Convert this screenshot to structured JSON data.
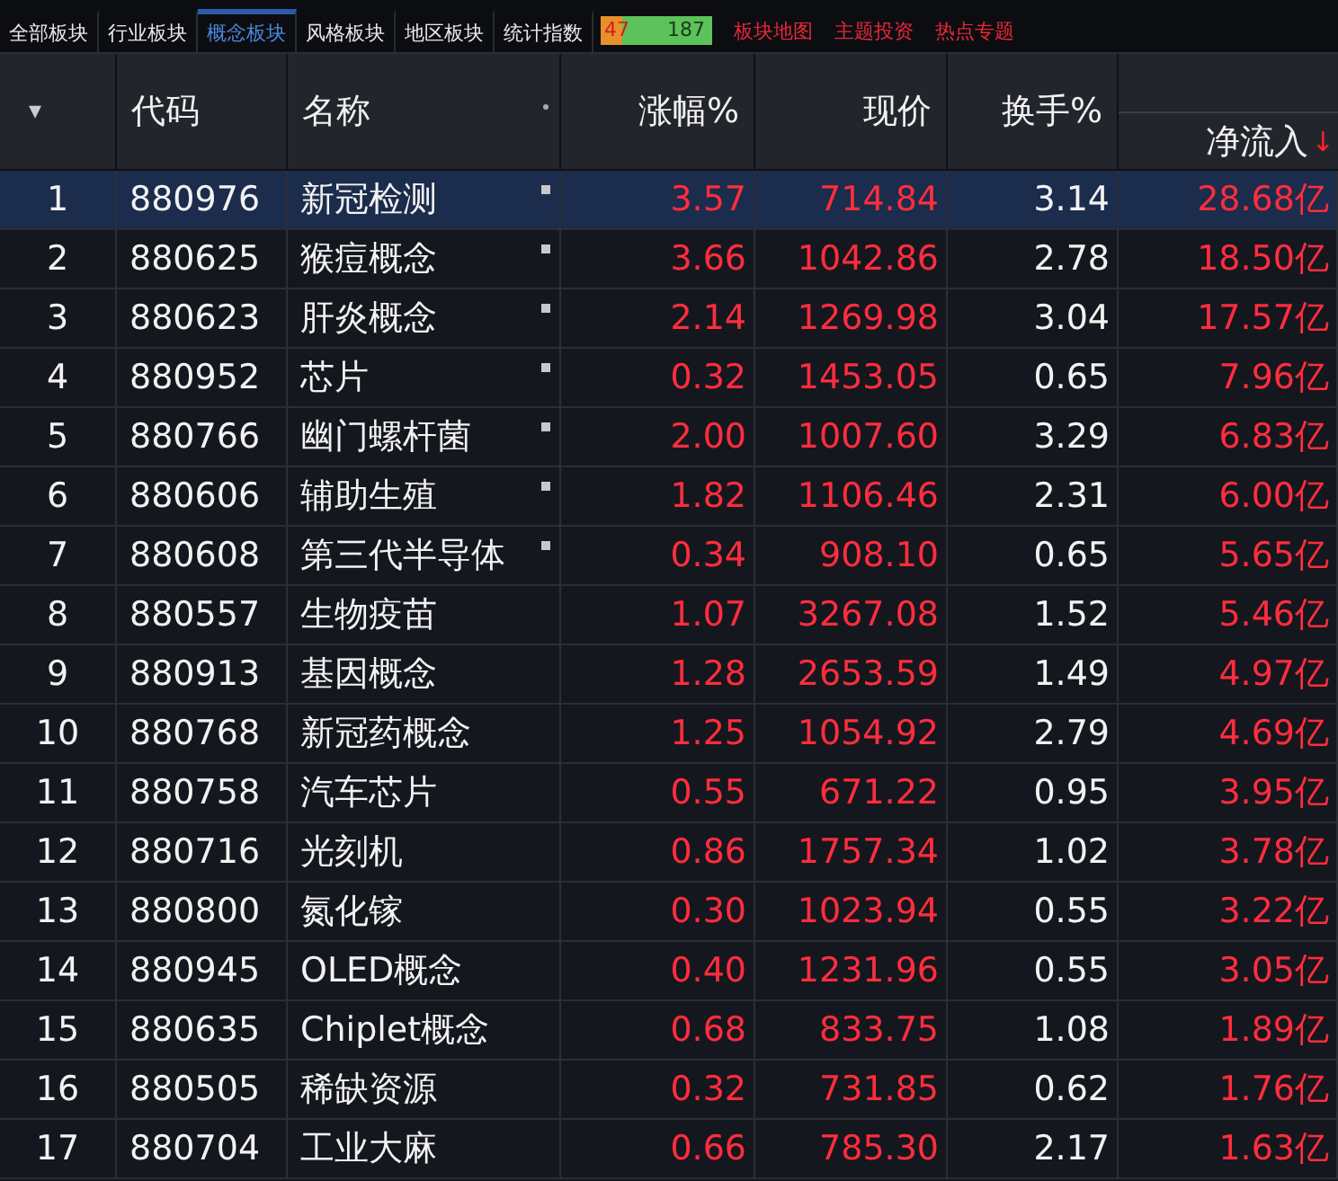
{
  "tabs": [
    {
      "label": "全部板块",
      "selected": false
    },
    {
      "label": "行业板块",
      "selected": false
    },
    {
      "label": "概念板块",
      "selected": true
    },
    {
      "label": "风格板块",
      "selected": false
    },
    {
      "label": "地区板块",
      "selected": false
    },
    {
      "label": "统计指数",
      "selected": false
    }
  ],
  "breadth": {
    "down": "47",
    "up": "187",
    "level": 0.2
  },
  "links": [
    "板块地图",
    "主题投资",
    "热点专题"
  ],
  "columns": {
    "sort_menu": "▾",
    "code": "代码",
    "name": "名称",
    "change": "涨幅%",
    "price": "现价",
    "turnover": "换手%",
    "net_inflow": "净流入",
    "sort_arrow": "↓"
  },
  "rows": [
    {
      "index": "1",
      "code": "880976",
      "name": "新冠检测",
      "marked": true,
      "selected": true,
      "change": "3.57",
      "price": "714.84",
      "turnover": "3.14",
      "net_inflow": "28.68亿"
    },
    {
      "index": "2",
      "code": "880625",
      "name": "猴痘概念",
      "marked": true,
      "selected": false,
      "change": "3.66",
      "price": "1042.86",
      "turnover": "2.78",
      "net_inflow": "18.50亿"
    },
    {
      "index": "3",
      "code": "880623",
      "name": "肝炎概念",
      "marked": true,
      "selected": false,
      "change": "2.14",
      "price": "1269.98",
      "turnover": "3.04",
      "net_inflow": "17.57亿"
    },
    {
      "index": "4",
      "code": "880952",
      "name": "芯片",
      "marked": true,
      "selected": false,
      "change": "0.32",
      "price": "1453.05",
      "turnover": "0.65",
      "net_inflow": "7.96亿"
    },
    {
      "index": "5",
      "code": "880766",
      "name": "幽门螺杆菌",
      "marked": true,
      "selected": false,
      "change": "2.00",
      "price": "1007.60",
      "turnover": "3.29",
      "net_inflow": "6.83亿"
    },
    {
      "index": "6",
      "code": "880606",
      "name": "辅助生殖",
      "marked": true,
      "selected": false,
      "change": "1.82",
      "price": "1106.46",
      "turnover": "2.31",
      "net_inflow": "6.00亿"
    },
    {
      "index": "7",
      "code": "880608",
      "name": "第三代半导体",
      "marked": true,
      "selected": false,
      "change": "0.34",
      "price": "908.10",
      "turnover": "0.65",
      "net_inflow": "5.65亿"
    },
    {
      "index": "8",
      "code": "880557",
      "name": "生物疫苗",
      "marked": false,
      "selected": false,
      "change": "1.07",
      "price": "3267.08",
      "turnover": "1.52",
      "net_inflow": "5.46亿"
    },
    {
      "index": "9",
      "code": "880913",
      "name": "基因概念",
      "marked": false,
      "selected": false,
      "change": "1.28",
      "price": "2653.59",
      "turnover": "1.49",
      "net_inflow": "4.97亿"
    },
    {
      "index": "10",
      "code": "880768",
      "name": "新冠药概念",
      "marked": false,
      "selected": false,
      "change": "1.25",
      "price": "1054.92",
      "turnover": "2.79",
      "net_inflow": "4.69亿"
    },
    {
      "index": "11",
      "code": "880758",
      "name": "汽车芯片",
      "marked": false,
      "selected": false,
      "change": "0.55",
      "price": "671.22",
      "turnover": "0.95",
      "net_inflow": "3.95亿"
    },
    {
      "index": "12",
      "code": "880716",
      "name": "光刻机",
      "marked": false,
      "selected": false,
      "change": "0.86",
      "price": "1757.34",
      "turnover": "1.02",
      "net_inflow": "3.78亿"
    },
    {
      "index": "13",
      "code": "880800",
      "name": "氮化镓",
      "marked": false,
      "selected": false,
      "change": "0.30",
      "price": "1023.94",
      "turnover": "0.55",
      "net_inflow": "3.22亿"
    },
    {
      "index": "14",
      "code": "880945",
      "name": "OLED概念",
      "marked": false,
      "selected": false,
      "change": "0.40",
      "price": "1231.96",
      "turnover": "0.55",
      "net_inflow": "3.05亿"
    },
    {
      "index": "15",
      "code": "880635",
      "name": "Chiplet概念",
      "marked": false,
      "selected": false,
      "change": "0.68",
      "price": "833.75",
      "turnover": "1.08",
      "net_inflow": "1.89亿"
    },
    {
      "index": "16",
      "code": "880505",
      "name": "稀缺资源",
      "marked": false,
      "selected": false,
      "change": "0.32",
      "price": "731.85",
      "turnover": "0.62",
      "net_inflow": "1.76亿"
    },
    {
      "index": "17",
      "code": "880704",
      "name": "工业大麻",
      "marked": false,
      "selected": false,
      "change": "0.66",
      "price": "785.30",
      "turnover": "2.17",
      "net_inflow": "1.63亿"
    }
  ]
}
